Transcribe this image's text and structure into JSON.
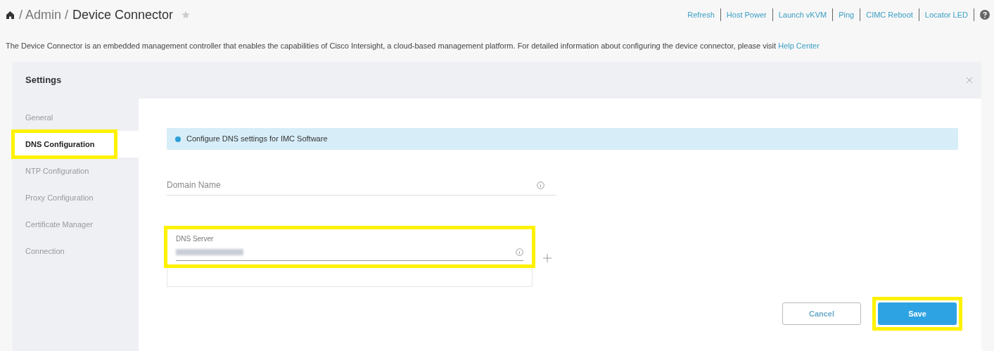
{
  "breadcrumb": {
    "items": [
      "/ Admin /",
      "Device Connector"
    ],
    "favorite": false
  },
  "header_actions": [
    "Refresh",
    "Host Power",
    "Launch vKVM",
    "Ping",
    "CIMC Reboot",
    "Locator LED"
  ],
  "description": {
    "text": "The Device Connector is an embedded management controller that enables the capabilities of Cisco Intersight, a cloud-based management platform. For detailed information about configuring the device connector, please visit",
    "link": "Help Center"
  },
  "settings": {
    "title": "Settings",
    "sidebar_items": [
      {
        "label": "General",
        "selected": false,
        "highlighted": false
      },
      {
        "label": "DNS Configuration",
        "selected": true,
        "highlighted": true
      },
      {
        "label": "NTP Configuration",
        "selected": false,
        "highlighted": false
      },
      {
        "label": "Proxy Configuration",
        "selected": false,
        "highlighted": false
      },
      {
        "label": "Certificate Manager",
        "selected": false,
        "highlighted": false
      },
      {
        "label": "Connection",
        "selected": false,
        "highlighted": false
      }
    ],
    "info_banner": "Configure DNS settings for IMC Software",
    "domain_name": {
      "placeholder": "Domain Name"
    },
    "dns_server": {
      "label": "DNS Server",
      "value_redacted": true,
      "highlighted": true
    },
    "buttons": [
      {
        "label": "Cancel",
        "kind": "secondary",
        "highlighted": false
      },
      {
        "label": "Save",
        "kind": "primary",
        "highlighted": true
      }
    ]
  }
}
